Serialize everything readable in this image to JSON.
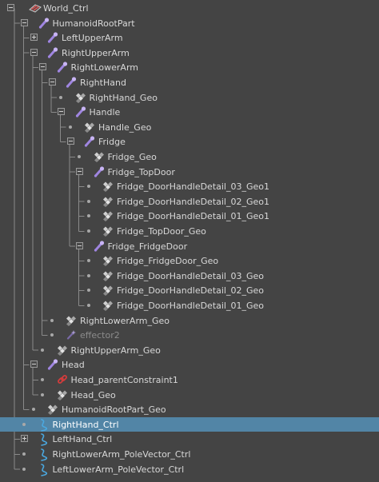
{
  "panel": "outliner",
  "colors": {
    "background": "#444444",
    "selection": "#5285a6",
    "text": "#d8d8d8",
    "dim_text": "#8c8c8c",
    "joint_icon": "#9f85e0",
    "curve_icon": "#4aa8e0",
    "constraint_icon": "#d23c3c",
    "mesh_icon": "#d0d0d0"
  },
  "items": [
    {
      "label": "World_Ctrl",
      "depth": 0,
      "icon": "world-transform-icon",
      "expander": "collapse"
    },
    {
      "label": "HumanoidRootPart",
      "depth": 1,
      "icon": "joint-icon",
      "expander": "collapse"
    },
    {
      "label": "LeftUpperArm",
      "depth": 2,
      "icon": "joint-icon",
      "expander": "expand"
    },
    {
      "label": "RightUpperArm",
      "depth": 2,
      "icon": "joint-icon",
      "expander": "collapse"
    },
    {
      "label": "RightLowerArm",
      "depth": 3,
      "icon": "joint-icon",
      "expander": "collapse"
    },
    {
      "label": "RightHand",
      "depth": 4,
      "icon": "joint-icon",
      "expander": "collapse"
    },
    {
      "label": "RightHand_Geo",
      "depth": 5,
      "icon": "mesh-icon",
      "expander": "none"
    },
    {
      "label": "Handle",
      "depth": 5,
      "icon": "joint-icon",
      "expander": "collapse"
    },
    {
      "label": "Handle_Geo",
      "depth": 6,
      "icon": "mesh-icon",
      "expander": "none"
    },
    {
      "label": "Fridge",
      "depth": 6,
      "icon": "joint-icon",
      "expander": "collapse"
    },
    {
      "label": "Fridge_Geo",
      "depth": 7,
      "icon": "mesh-icon",
      "expander": "none"
    },
    {
      "label": "Fridge_TopDoor",
      "depth": 7,
      "icon": "joint-icon",
      "expander": "collapse"
    },
    {
      "label": "Fridge_DoorHandleDetail_03_Geo1",
      "depth": 8,
      "icon": "mesh-icon",
      "expander": "none"
    },
    {
      "label": "Fridge_DoorHandleDetail_02_Geo1",
      "depth": 8,
      "icon": "mesh-icon",
      "expander": "none"
    },
    {
      "label": "Fridge_DoorHandleDetail_01_Geo1",
      "depth": 8,
      "icon": "mesh-icon",
      "expander": "none"
    },
    {
      "label": "Fridge_TopDoor_Geo",
      "depth": 8,
      "icon": "mesh-icon",
      "expander": "none"
    },
    {
      "label": "Fridge_FridgeDoor",
      "depth": 7,
      "icon": "joint-icon",
      "expander": "collapse"
    },
    {
      "label": "Fridge_FridgeDoor_Geo",
      "depth": 8,
      "icon": "mesh-icon",
      "expander": "none"
    },
    {
      "label": "Fridge_DoorHandleDetail_03_Geo",
      "depth": 8,
      "icon": "mesh-icon",
      "expander": "none"
    },
    {
      "label": "Fridge_DoorHandleDetail_02_Geo",
      "depth": 8,
      "icon": "mesh-icon",
      "expander": "none"
    },
    {
      "label": "Fridge_DoorHandleDetail_01_Geo",
      "depth": 8,
      "icon": "mesh-icon",
      "expander": "none"
    },
    {
      "label": "RightLowerArm_Geo",
      "depth": 4,
      "icon": "mesh-icon",
      "expander": "none"
    },
    {
      "label": "effector2",
      "depth": 4,
      "icon": "effector-icon",
      "expander": "none",
      "dim": true
    },
    {
      "label": "RightUpperArm_Geo",
      "depth": 3,
      "icon": "mesh-icon",
      "expander": "none"
    },
    {
      "label": "Head",
      "depth": 2,
      "icon": "joint-icon",
      "expander": "collapse"
    },
    {
      "label": "Head_parentConstraint1",
      "depth": 3,
      "icon": "constraint-icon",
      "expander": "none"
    },
    {
      "label": "Head_Geo",
      "depth": 3,
      "icon": "mesh-icon",
      "expander": "none"
    },
    {
      "label": "HumanoidRootPart_Geo",
      "depth": 2,
      "icon": "mesh-icon",
      "expander": "none"
    },
    {
      "label": "RightHand_Ctrl",
      "depth": 1,
      "icon": "nurbs-curve-icon",
      "expander": "none",
      "selected": true
    },
    {
      "label": "LeftHand_Ctrl",
      "depth": 1,
      "icon": "nurbs-curve-icon",
      "expander": "expand"
    },
    {
      "label": "RightLowerArm_PoleVector_Ctrl",
      "depth": 1,
      "icon": "nurbs-curve-icon",
      "expander": "none"
    },
    {
      "label": "LeftLowerArm_PoleVector_Ctrl",
      "depth": 1,
      "icon": "nurbs-curve-icon",
      "expander": "none"
    }
  ]
}
